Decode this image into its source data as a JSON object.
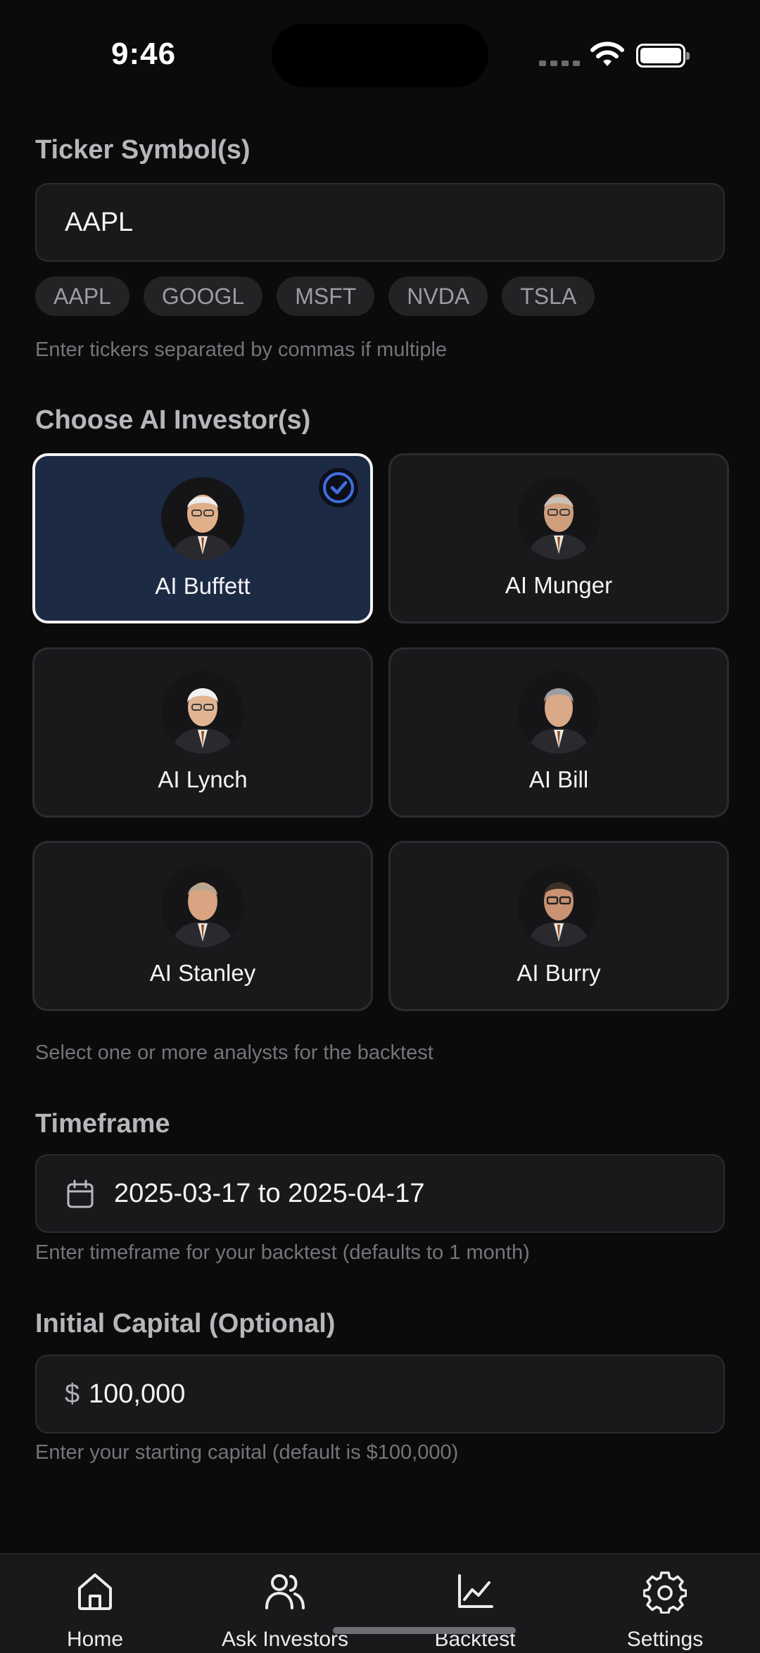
{
  "status_bar": {
    "time": "9:46"
  },
  "ticker": {
    "label": "Ticker Symbol(s)",
    "value": "AAPL",
    "chips": [
      "AAPL",
      "GOOGL",
      "MSFT",
      "NVDA",
      "TSLA"
    ],
    "hint": "Enter tickers separated by commas if multiple"
  },
  "investors": {
    "label": "Choose AI Investor(s)",
    "items": [
      {
        "name": "AI Buffett",
        "selected": true
      },
      {
        "name": "AI Munger",
        "selected": false
      },
      {
        "name": "AI Lynch",
        "selected": false
      },
      {
        "name": "AI Bill",
        "selected": false
      },
      {
        "name": "AI Stanley",
        "selected": false
      },
      {
        "name": "AI Burry",
        "selected": false
      }
    ],
    "hint": "Select one or more analysts for the backtest"
  },
  "timeframe": {
    "label": "Timeframe",
    "value": "2025-03-17 to 2025-04-17",
    "hint": "Enter timeframe for your backtest (defaults to 1 month)"
  },
  "capital": {
    "label": "Initial Capital (Optional)",
    "currency": "$",
    "value": "100,000",
    "hint": "Enter your starting capital (default is $100,000)"
  },
  "tabbar": {
    "tabs": [
      {
        "label": "Home",
        "icon": "home-icon"
      },
      {
        "label": "Ask Investors",
        "icon": "users-icon"
      },
      {
        "label": "Backtest",
        "icon": "chart-icon"
      },
      {
        "label": "Settings",
        "icon": "gear-icon"
      }
    ]
  },
  "colors": {
    "background": "#0b0b0c",
    "selected_card": "#1c2a44",
    "accent": "#3f6fe0"
  }
}
